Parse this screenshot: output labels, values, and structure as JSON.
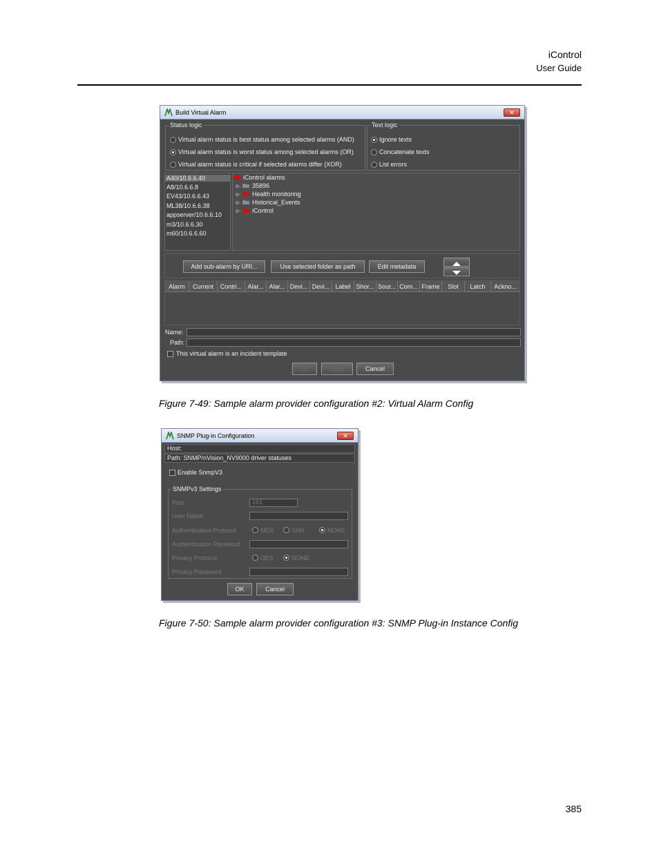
{
  "header": {
    "title": "iControl",
    "subtitle": "User Guide"
  },
  "figure1": {
    "window_title": "Build Virtual Alarm",
    "status_logic": {
      "label": "Status logic",
      "options": [
        "Virtual alarm status is best status among selected alarms (AND)",
        "Virtual alarm status is worst status among selected alarms (OR)",
        "Virtual alarm status is critical if selected alarms differ (XOR)"
      ],
      "selected_index": 1
    },
    "text_logic": {
      "label": "Text logic",
      "options": [
        "Ignore texts",
        "Concatenate texts",
        "List errors"
      ],
      "selected_index": 0
    },
    "servers": [
      "A40/10.6.6.40",
      "A8/10.6.6.8",
      "EV43/10.6.6.43",
      "ML38/10.6.6.38",
      "appserver/10.6.6.10",
      "m3/10.6.6.30",
      "m60/10.6.6.60"
    ],
    "tree": {
      "root": "iControl alarms",
      "children": [
        "35896",
        "Health monitoring",
        "Historical_Events",
        "iControl"
      ]
    },
    "buttons": {
      "add_sub_alarm": "Add sub-alarm by URI...",
      "use_folder": "Use selected folder as path",
      "edit_metadata": "Edit metadata",
      "ok": "OK",
      "apply": "Apply",
      "cancel": "Cancel"
    },
    "columns": [
      "Alarm",
      "Current",
      "Contri...",
      "Alar...",
      "Alar...",
      "Devi...",
      "Devi...",
      "Label",
      "Shor...",
      "Sour...",
      "Com...",
      "Frame",
      "Slot",
      "Latch",
      "Ackno..."
    ],
    "name_label": "Name:",
    "path_label": "Path:",
    "incident_template": "This virtual alarm is an incident template"
  },
  "caption1": "Figure 7-49:  Sample alarm provider configuration #2: Virtual Alarm Config",
  "figure2": {
    "window_title": "SNMP Plug-in Configuration",
    "host_label": "Host:",
    "path_text": "Path: SNMP/nVision_NV9000 driver statuses",
    "enable_snmpv3": "Enable SnmpV3",
    "settings_label": "SNMPv3 Settings",
    "port_label": "Port",
    "port_value": "161",
    "user_name_label": "User Name",
    "auth_protocol_label": "Authentication Protocol",
    "auth_options": [
      "MD5",
      "SHA",
      "NONE"
    ],
    "auth_selected": 2,
    "auth_password_label": "Authentication Password",
    "privacy_protocol_label": "Privacy Protocol",
    "privacy_options": [
      "DES",
      "NONE"
    ],
    "privacy_selected": 1,
    "privacy_password_label": "Privacy Password",
    "ok": "OK",
    "cancel": "Cancel"
  },
  "caption2": "Figure 7-50:  Sample alarm provider configuration #3: SNMP Plug-in Instance Config",
  "page_number": "385",
  "colors": {
    "window_bg": "#4a4a4a",
    "titlebar": "#dce6f3",
    "close": "#c0392b",
    "folder": "#cc1111"
  }
}
